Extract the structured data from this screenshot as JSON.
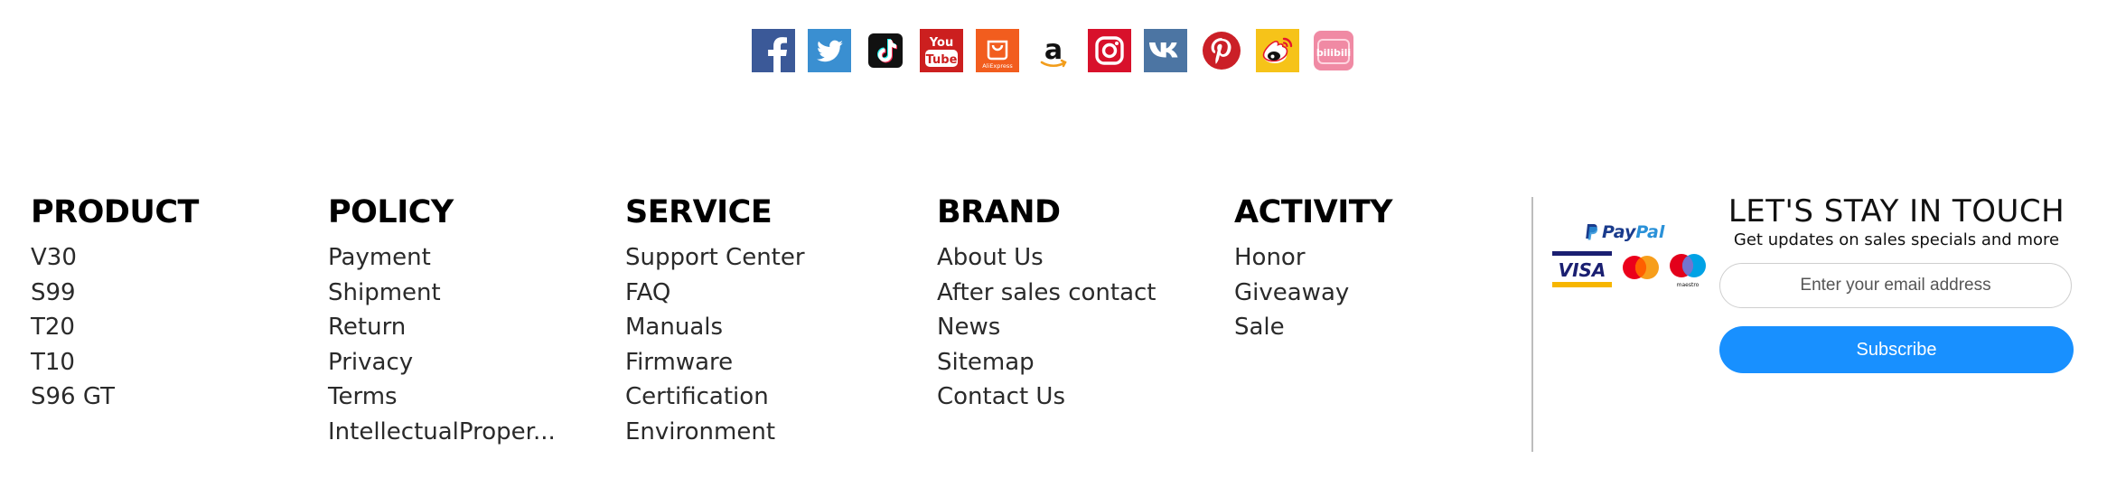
{
  "social_icons": [
    {
      "name": "facebook-icon",
      "color": "#3b5998"
    },
    {
      "name": "twitter-icon",
      "color": "#3a8fd1"
    },
    {
      "name": "tiktok-icon",
      "color": "#111111"
    },
    {
      "name": "youtube-icon",
      "color": "#cc1f1f"
    },
    {
      "name": "aliexpress-icon",
      "color": "#f25d1e"
    },
    {
      "name": "amazon-icon",
      "color": "#111111"
    },
    {
      "name": "instagram-icon",
      "color": "#d8112b"
    },
    {
      "name": "vk-icon",
      "color": "#4c75a3"
    },
    {
      "name": "pinterest-icon",
      "color": "#cb1f27"
    },
    {
      "name": "weibo-icon",
      "color": "#f6c319"
    },
    {
      "name": "bilibili-icon",
      "color": "#f08aa4"
    }
  ],
  "social_text": {
    "youtube_top": "You",
    "youtube_bottom": "Tube",
    "aliexpress": "AliExpress",
    "amazon": "a",
    "bilibili": "bilibili"
  },
  "footer": {
    "product": {
      "title": "PRODUCT",
      "items": [
        "V30",
        "S99",
        "T20",
        "T10",
        "S96 GT"
      ]
    },
    "policy": {
      "title": "POLICY",
      "items": [
        "Payment",
        "Shipment",
        "Return",
        "Privacy",
        "Terms",
        "IntellectualProper..."
      ]
    },
    "service": {
      "title": "SERVICE",
      "items": [
        "Support Center",
        "FAQ",
        "Manuals",
        "Firmware",
        "Certification",
        "Environment"
      ]
    },
    "brand": {
      "title": "BRAND",
      "items": [
        "About Us",
        "After sales contact",
        "News",
        "Sitemap",
        "Contact Us"
      ]
    },
    "activity": {
      "title": "ACTIVITY",
      "items": [
        "Honor",
        "Giveaway",
        "Sale"
      ]
    }
  },
  "payments": {
    "paypal_label_1": "Pay",
    "paypal_label_2": "Pal",
    "visa_label": "VISA",
    "maestro_label": "maestro"
  },
  "newsletter": {
    "title": "LET'S STAY IN TOUCH",
    "subtitle": "Get updates on sales specials and more",
    "email_placeholder": "Enter your email address",
    "subscribe_label": "Subscribe"
  },
  "colors": {
    "accent": "#1890ff",
    "divider": "#bdbdbd"
  }
}
